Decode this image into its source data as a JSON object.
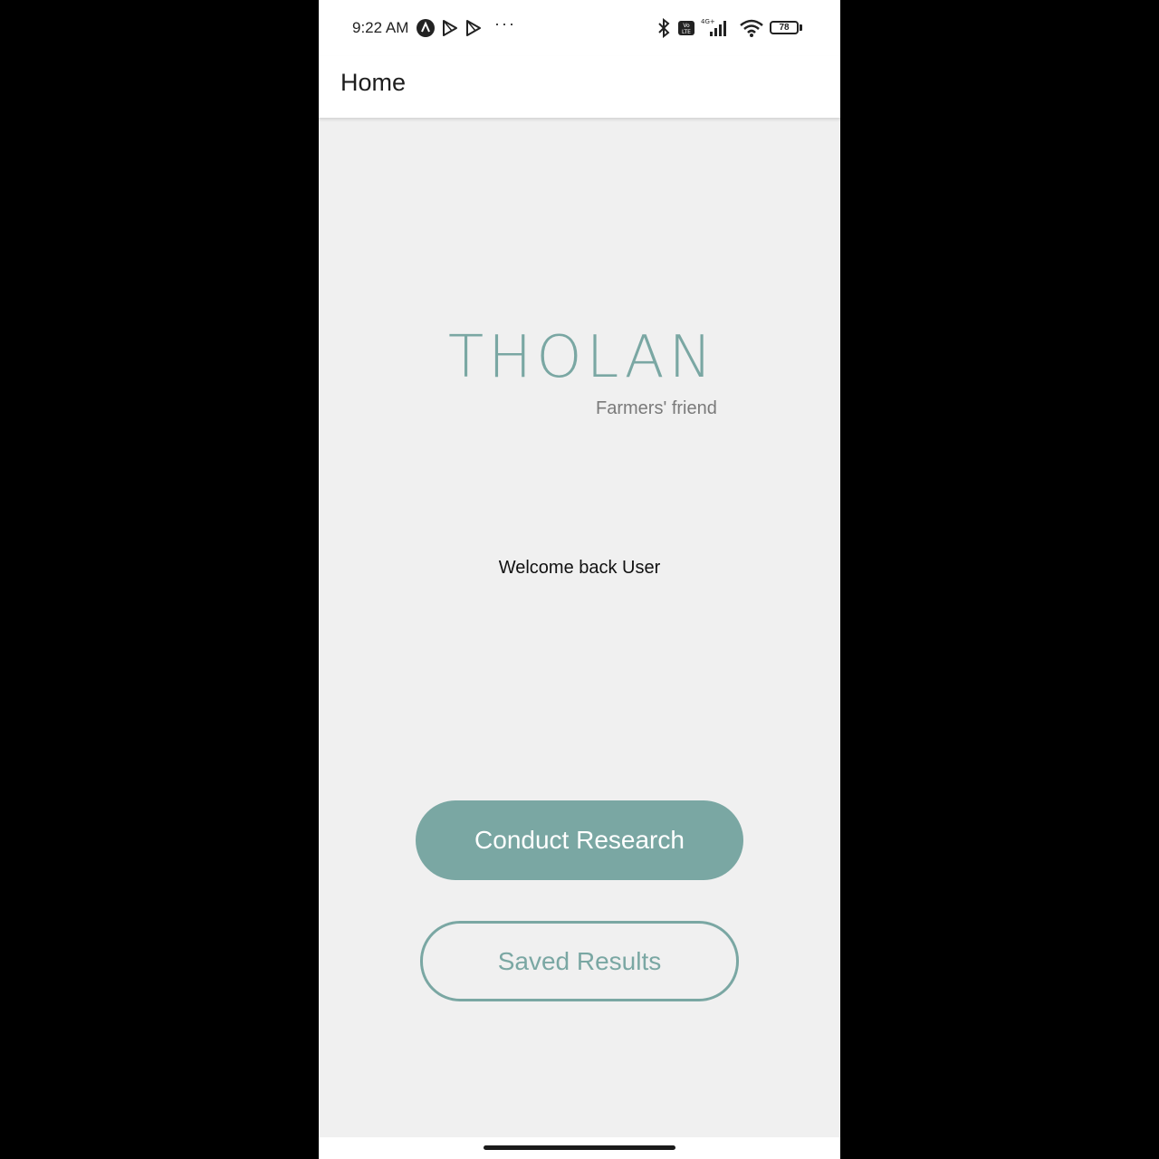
{
  "status_bar": {
    "time": "9:22 AM",
    "overflow": "···",
    "battery_level": "78",
    "icons": [
      "app-a-icon",
      "play-store-icon",
      "play-store-icon",
      "bluetooth-icon",
      "volte-icon",
      "signal-4g-icon",
      "wifi-icon",
      "battery-icon"
    ]
  },
  "app_bar": {
    "title": "Home"
  },
  "logo": {
    "name": "THOLAN",
    "tagline": "Farmers' friend"
  },
  "main": {
    "welcome": "Welcome back User",
    "conduct_research_label": "Conduct Research",
    "saved_results_label": "Saved Results"
  },
  "colors": {
    "accent": "#7aa7a3",
    "background": "#f0f0f0",
    "app_bar": "#ffffff"
  }
}
